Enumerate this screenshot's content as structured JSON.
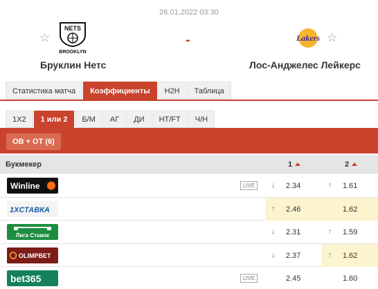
{
  "match": {
    "datetime": "26.01.2022 03:30",
    "home": {
      "name": "Бруклин Нетс",
      "logo_top": "NETS",
      "logo_bottom": "BROOKLYN"
    },
    "away": {
      "name": "Лос-Анджелес Лейкерс",
      "logo_text": "Lakers"
    },
    "score": "-",
    "colors": {
      "accent": "#c9432d",
      "highlight": "#fcf4ce",
      "up": "#3a9f3a",
      "down": "#c9432d"
    }
  },
  "tabs": [
    {
      "label": "Статистика матча",
      "active": false
    },
    {
      "label": "Коэффициенты",
      "active": true
    },
    {
      "label": "H2H",
      "active": false
    },
    {
      "label": "Таблица",
      "active": false
    }
  ],
  "subtabs": [
    {
      "label": "1X2",
      "active": false
    },
    {
      "label": "1 или 2",
      "active": true
    },
    {
      "label": "Б/М",
      "active": false
    },
    {
      "label": "АГ",
      "active": false
    },
    {
      "label": "ДИ",
      "active": false
    },
    {
      "label": "HT/FT",
      "active": false
    },
    {
      "label": "Ч/Н",
      "active": false
    }
  ],
  "market": {
    "label": "OB + OT (6)"
  },
  "table": {
    "header": {
      "bookmaker": "Букмекер",
      "col1": "1",
      "col2": "2"
    },
    "rows": [
      {
        "bookmaker": "Winline",
        "live": "LIVE",
        "odd1": "2.34",
        "arrow1": "down",
        "hl1": false,
        "odd2": "1.61",
        "arrow2": "up",
        "hl2": false
      },
      {
        "bookmaker": "1XСТАВКА",
        "live": "",
        "odd1": "2.46",
        "arrow1": "up",
        "hl1": true,
        "odd2": "1.62",
        "arrow2": "none",
        "hl2": true
      },
      {
        "bookmaker": "Лига Ставок",
        "live": "",
        "odd1": "2.31",
        "arrow1": "down",
        "hl1": false,
        "odd2": "1.59",
        "arrow2": "up",
        "hl2": false
      },
      {
        "bookmaker": "OLIMPBET",
        "live": "",
        "odd1": "2.37",
        "arrow1": "down",
        "hl1": false,
        "odd2": "1.62",
        "arrow2": "up",
        "hl2": true
      },
      {
        "bookmaker": "bet365",
        "live": "LIVE",
        "odd1": "2.45",
        "arrow1": "none",
        "hl1": false,
        "odd2": "1.60",
        "arrow2": "none",
        "hl2": false
      }
    ]
  }
}
